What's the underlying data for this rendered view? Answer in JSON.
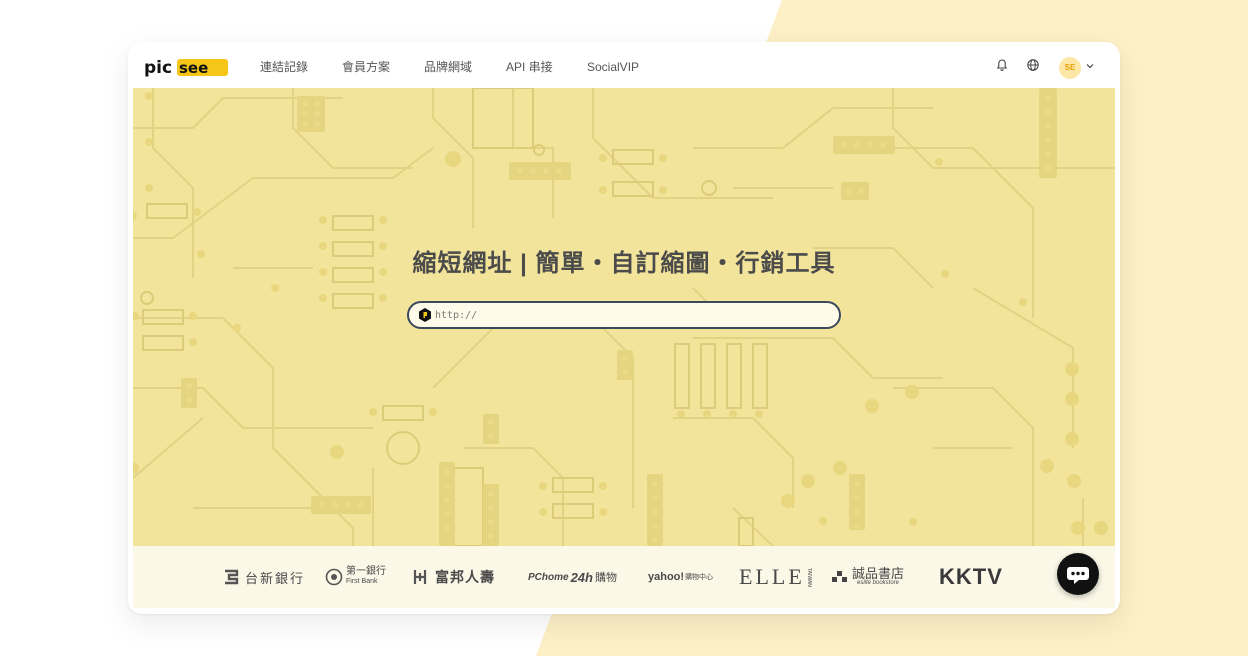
{
  "brand": {
    "logo_text": "picsee",
    "accent_color": "#f5c518",
    "dark_color": "#111111"
  },
  "nav": {
    "items": [
      {
        "label": "連結記錄"
      },
      {
        "label": "會員方案"
      },
      {
        "label": "品牌網域"
      },
      {
        "label": "API 串接"
      },
      {
        "label": "SocialVIP"
      }
    ],
    "icons": [
      "bell-icon",
      "globe-icon",
      "chevron-down-icon"
    ],
    "avatar_text": "SE"
  },
  "hero": {
    "headline": "縮短網址 | 簡單・自訂縮圖・行銷工具",
    "background_color": "#f2e49a",
    "url_input": {
      "value": "",
      "placeholder": "http://"
    }
  },
  "partners": [
    {
      "name": "台新銀行"
    },
    {
      "name": "第一銀行",
      "sub": "First Bank"
    },
    {
      "name": "富邦人壽"
    },
    {
      "name": "PChome",
      "badge": "24h",
      "suffix": "購物"
    },
    {
      "name": "yahoo!",
      "suffix": "購物中心"
    },
    {
      "name": "ELLE",
      "sub": "TAIWAN"
    },
    {
      "name": "誠品書店",
      "sub": "eslite bookstore"
    },
    {
      "name": "KKTV"
    }
  ],
  "chat": {
    "icon": "chat-bubble-icon"
  }
}
